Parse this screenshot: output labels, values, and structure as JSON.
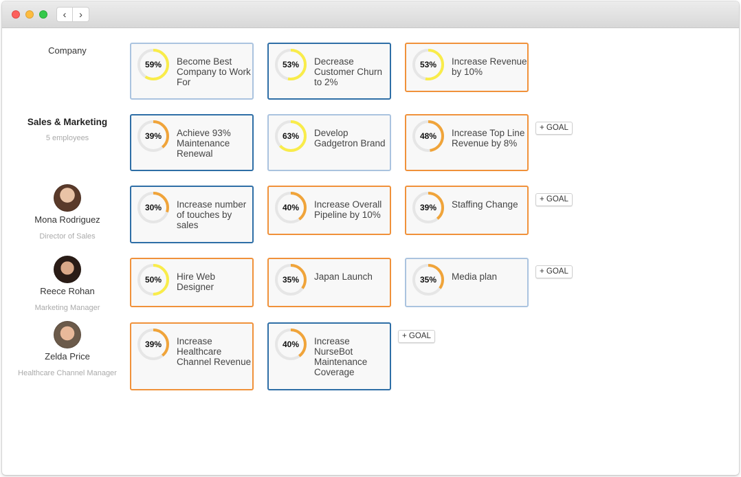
{
  "window": {
    "nav_back": "‹",
    "nav_forward": "›"
  },
  "colors": {
    "ring_yellow": "#f9ec4a",
    "ring_orange": "#f0a43a",
    "ring_track": "#e6e6e6",
    "border_light": "#aac3df",
    "border_blue": "#2e6ea6",
    "border_orange": "#f0913a"
  },
  "add_goal_label": "+ GOAL",
  "rows": [
    {
      "name": "Company",
      "goals": [
        {
          "pct": "59%",
          "progress": 0.59,
          "ring": "yellow",
          "border": "light",
          "title": "Become Best Company to Work For"
        },
        {
          "pct": "53%",
          "progress": 0.53,
          "ring": "yellow",
          "border": "blue",
          "title": "Decrease Customer Churn to 2%"
        },
        {
          "pct": "53%",
          "progress": 0.53,
          "ring": "yellow",
          "border": "orange",
          "title": "Increase Revenue by 10%"
        }
      ]
    },
    {
      "name": "Sales & Marketing",
      "subtitle": "5 employees",
      "goals": [
        {
          "pct": "39%",
          "progress": 0.39,
          "ring": "orange",
          "border": "blue",
          "title": "Achieve 93% Maintenance Renewal"
        },
        {
          "pct": "63%",
          "progress": 0.63,
          "ring": "yellow",
          "border": "light",
          "title": "Develop Gadgetron Brand"
        },
        {
          "pct": "48%",
          "progress": 0.48,
          "ring": "orange",
          "border": "orange",
          "title": "Increase Top Line Revenue by 8%"
        }
      ]
    },
    {
      "name": "Mona Rodriguez",
      "subtitle": "Director of Sales",
      "goals": [
        {
          "pct": "30%",
          "progress": 0.3,
          "ring": "orange",
          "border": "blue",
          "title": "Increase number of touches by sales"
        },
        {
          "pct": "40%",
          "progress": 0.4,
          "ring": "orange",
          "border": "orange",
          "title": "Increase Overall Pipeline by 10%"
        },
        {
          "pct": "39%",
          "progress": 0.39,
          "ring": "orange",
          "border": "orange",
          "title": "Staffing Change"
        }
      ]
    },
    {
      "name": "Reece Rohan",
      "subtitle": "Marketing Manager",
      "goals": [
        {
          "pct": "50%",
          "progress": 0.5,
          "ring": "yellow",
          "border": "orange",
          "title": "Hire Web Designer"
        },
        {
          "pct": "35%",
          "progress": 0.35,
          "ring": "orange",
          "border": "orange",
          "title": "Japan Launch"
        },
        {
          "pct": "35%",
          "progress": 0.35,
          "ring": "orange",
          "border": "light",
          "title": "Media plan"
        }
      ]
    },
    {
      "name": "Zelda Price",
      "subtitle": "Healthcare Channel Manager",
      "goals": [
        {
          "pct": "39%",
          "progress": 0.39,
          "ring": "orange",
          "border": "orange",
          "title": "Increase Healthcare Channel Revenue"
        },
        {
          "pct": "40%",
          "progress": 0.4,
          "ring": "orange",
          "border": "blue",
          "title": "Increase NurseBot Maintenance Coverage"
        }
      ]
    }
  ]
}
